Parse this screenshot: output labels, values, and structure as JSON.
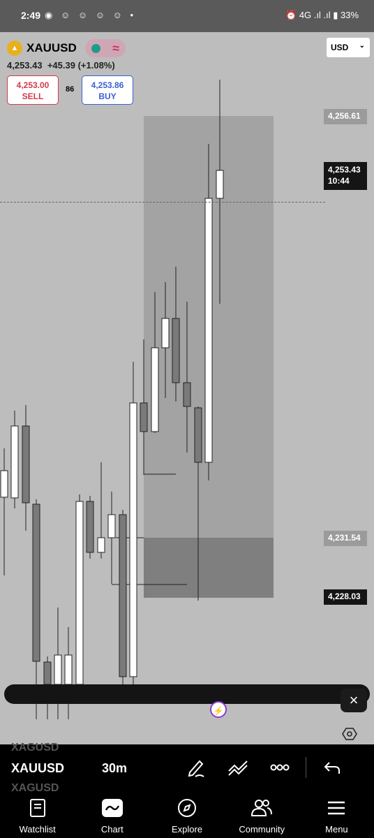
{
  "status": {
    "time": "2:49",
    "notifications": "◉ ☺ ☺ ☺ ☺ •",
    "right": "⏰ 4G .ıl .ıl ▮ 33%"
  },
  "symbol": {
    "name": "XAUUSD",
    "price": "4,253.43",
    "change": "+45.39 (+1.08%)"
  },
  "trade": {
    "sell_price": "4,253.00",
    "sell_label": "SELL",
    "spread": "86",
    "buy_price": "4,253.86",
    "buy_label": "BUY"
  },
  "currency": {
    "value": "USD"
  },
  "price_labels": {
    "high": "4,256.61",
    "current": "4,253.43",
    "countdown": "10:44",
    "zone_top": "4,231.54",
    "zone_bottom": "4,228.03"
  },
  "colors": {
    "bullish": "#ffffff",
    "bearish": "#7a7a7a",
    "chart_bg": "#bdbdbd"
  },
  "toolbar": {
    "ghost_prev": "XAGUSD",
    "symbol": "XAUUSD",
    "timeframe": "30m",
    "ghost_next": "XAGUSD"
  },
  "nav": [
    {
      "label": "Watchlist",
      "icon": "book-icon"
    },
    {
      "label": "Chart",
      "icon": "chart-icon"
    },
    {
      "label": "Explore",
      "icon": "compass-icon"
    },
    {
      "label": "Community",
      "icon": "people-icon"
    },
    {
      "label": "Menu",
      "icon": "menu-icon"
    }
  ]
}
